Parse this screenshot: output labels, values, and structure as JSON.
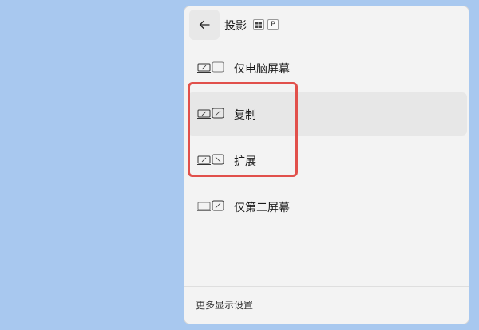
{
  "header": {
    "title": "投影",
    "shortcut_keys": [
      "⊞",
      "P"
    ]
  },
  "modes": [
    {
      "label": "仅电脑屏幕",
      "icon": "pc-screen-only-icon",
      "selected": false
    },
    {
      "label": "复制",
      "icon": "duplicate-icon",
      "selected": true
    },
    {
      "label": "扩展",
      "icon": "extend-icon",
      "selected": false
    },
    {
      "label": "仅第二屏幕",
      "icon": "second-screen-only-icon",
      "selected": false
    }
  ],
  "footer": {
    "link_label": "更多显示设置"
  },
  "colors": {
    "desktop_background": "#a8c8ef",
    "panel_background": "#f3f3f3",
    "selected_background": "#e7e7e7",
    "annotation": "#e1504b"
  }
}
